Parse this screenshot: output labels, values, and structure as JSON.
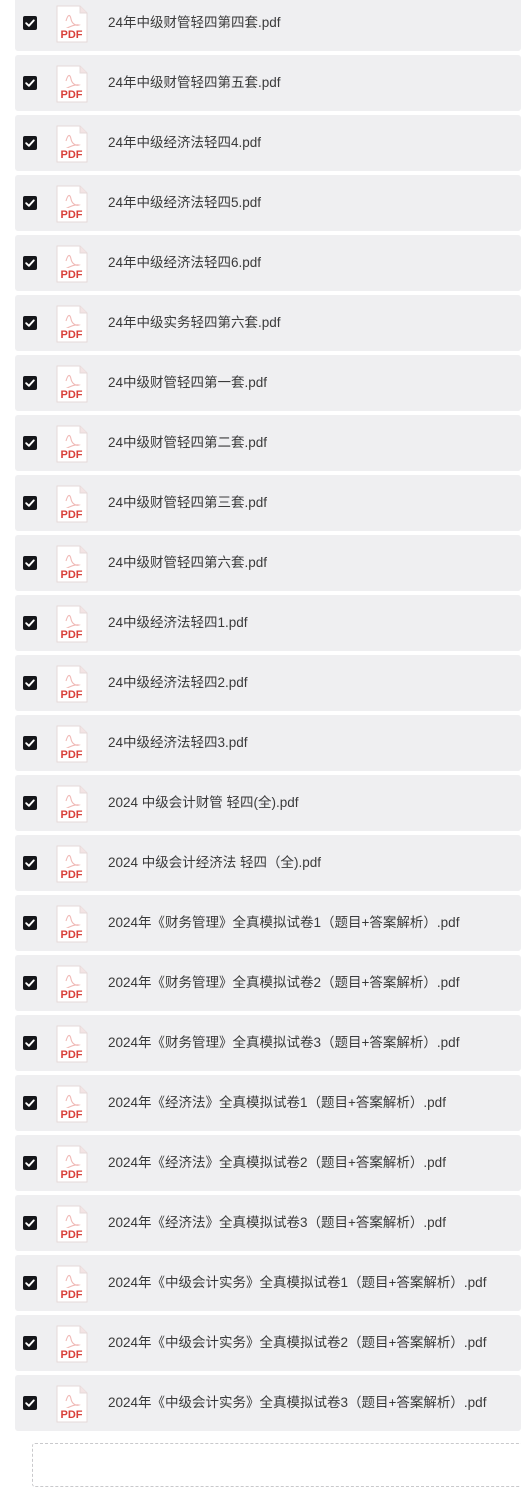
{
  "file_icon": {
    "name": "pdf-file-icon",
    "text": "PDF",
    "accent": "#d9403a"
  },
  "checkbox": {
    "state": "checked",
    "color": "#15161a"
  },
  "files": [
    {
      "name": "24年中级财管轻四第四套.pdf",
      "checked": true
    },
    {
      "name": "24年中级财管轻四第五套.pdf",
      "checked": true
    },
    {
      "name": "24年中级经济法轻四4.pdf",
      "checked": true
    },
    {
      "name": "24年中级经济法轻四5.pdf",
      "checked": true
    },
    {
      "name": "24年中级经济法轻四6.pdf",
      "checked": true
    },
    {
      "name": "24年中级实务轻四第六套.pdf",
      "checked": true
    },
    {
      "name": "24中级财管轻四第一套.pdf",
      "checked": true
    },
    {
      "name": "24中级财管轻四第二套.pdf",
      "checked": true
    },
    {
      "name": "24中级财管轻四第三套.pdf",
      "checked": true
    },
    {
      "name": "24中级财管轻四第六套.pdf",
      "checked": true
    },
    {
      "name": "24中级经济法轻四1.pdf",
      "checked": true
    },
    {
      "name": "24中级经济法轻四2.pdf",
      "checked": true
    },
    {
      "name": "24中级经济法轻四3.pdf",
      "checked": true
    },
    {
      "name": "2024 中级会计财管 轻四(全).pdf",
      "checked": true
    },
    {
      "name": "2024 中级会计经济法 轻四（全).pdf",
      "checked": true
    },
    {
      "name": "2024年《财务管理》全真模拟试卷1（题目+答案解析）.pdf",
      "checked": true
    },
    {
      "name": "2024年《财务管理》全真模拟试卷2（题目+答案解析）.pdf",
      "checked": true
    },
    {
      "name": "2024年《财务管理》全真模拟试卷3（题目+答案解析）.pdf",
      "checked": true
    },
    {
      "name": "2024年《经济法》全真模拟试卷1（题目+答案解析）.pdf",
      "checked": true
    },
    {
      "name": "2024年《经济法》全真模拟试卷2（题目+答案解析）.pdf",
      "checked": true
    },
    {
      "name": "2024年《经济法》全真模拟试卷3（题目+答案解析）.pdf",
      "checked": true
    },
    {
      "name": "2024年《中级会计实务》全真模拟试卷1（题目+答案解析）.pdf",
      "checked": true
    },
    {
      "name": "2024年《中级会计实务》全真模拟试卷2（题目+答案解析）.pdf",
      "checked": true
    },
    {
      "name": "2024年《中级会计实务》全真模拟试卷3（题目+答案解析）.pdf",
      "checked": true
    }
  ]
}
